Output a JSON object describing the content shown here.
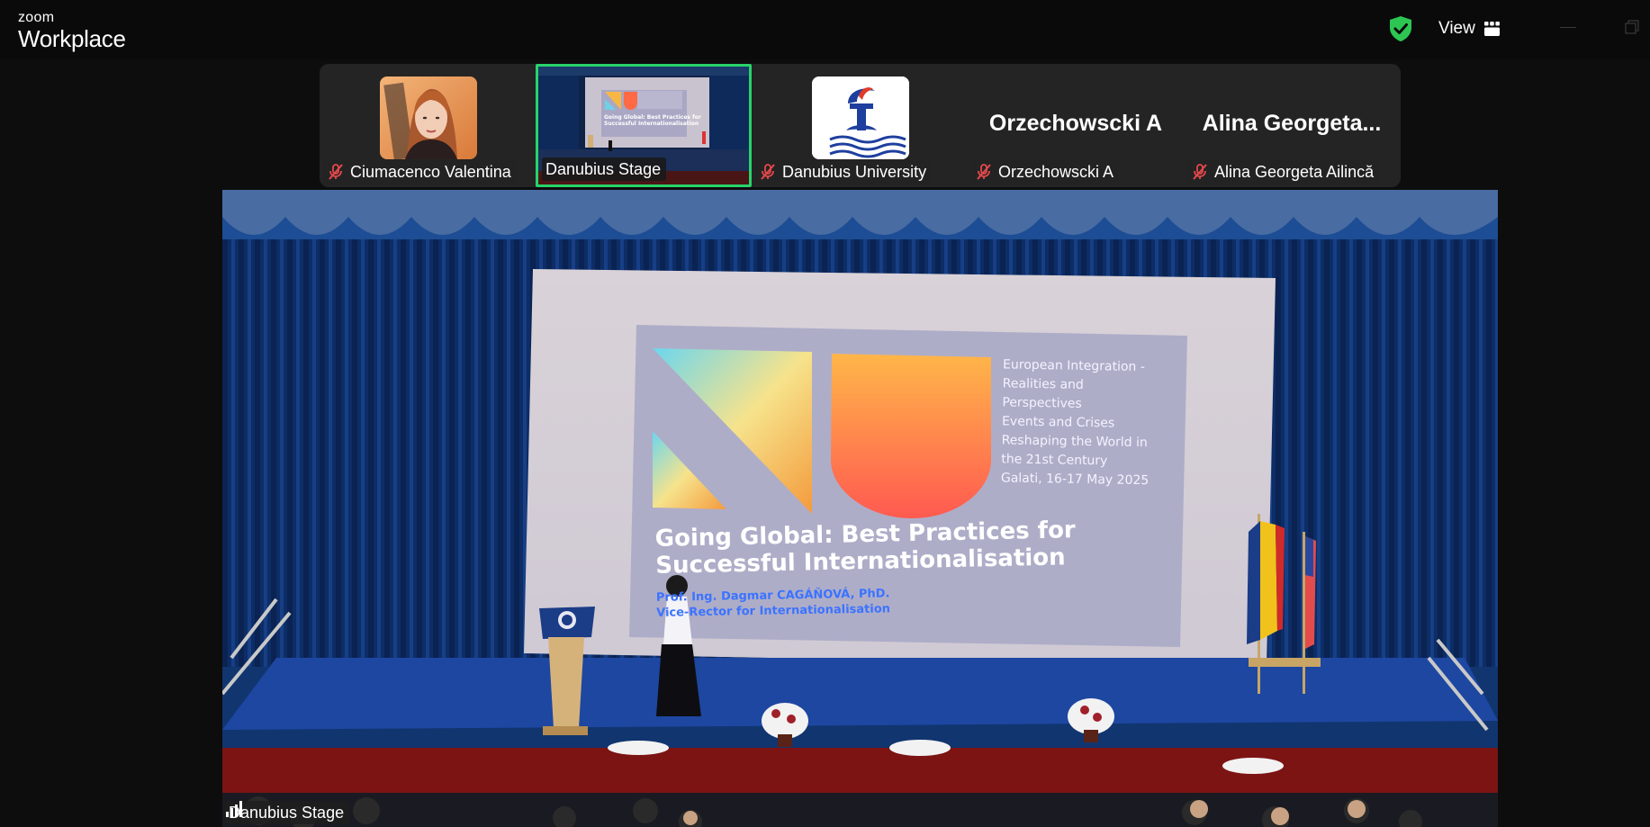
{
  "app": {
    "brand_top": "zoom",
    "brand_bottom": "Workplace",
    "view_label": "View"
  },
  "thumbnails": [
    {
      "name": "Ciumacenco Valentina",
      "muted": true,
      "type": "photo"
    },
    {
      "name": "Danubius Stage",
      "muted": false,
      "type": "video",
      "active": true
    },
    {
      "name": "Danubius University",
      "muted": true,
      "type": "logo"
    },
    {
      "name": "Orzechowscki A",
      "muted": true,
      "type": "name",
      "display": "Orzechowscki A"
    },
    {
      "name": "Alina Georgeta Ailincă",
      "muted": true,
      "type": "name",
      "display": "Alina  Georgeta..."
    }
  ],
  "main_video": {
    "label": "Danubius Stage",
    "slide": {
      "subtitle_lines": [
        "European Integration -",
        "Realities and",
        "Perspectives",
        "Events and Crises",
        "Reshaping the World in",
        "the 21st Century",
        "Galati, 16-17 May 2025"
      ],
      "title": "Going Global: Best Practices for Successful Internationalisation",
      "author_line1": "Prof. Ing. Dagmar CAGÁŇOVÁ, PhD.",
      "author_line2": "Vice-Rector for Internationalisation"
    }
  },
  "colors": {
    "accent_active": "#27d36b",
    "muted_red": "#e5484d",
    "security_green": "#2dc653"
  }
}
